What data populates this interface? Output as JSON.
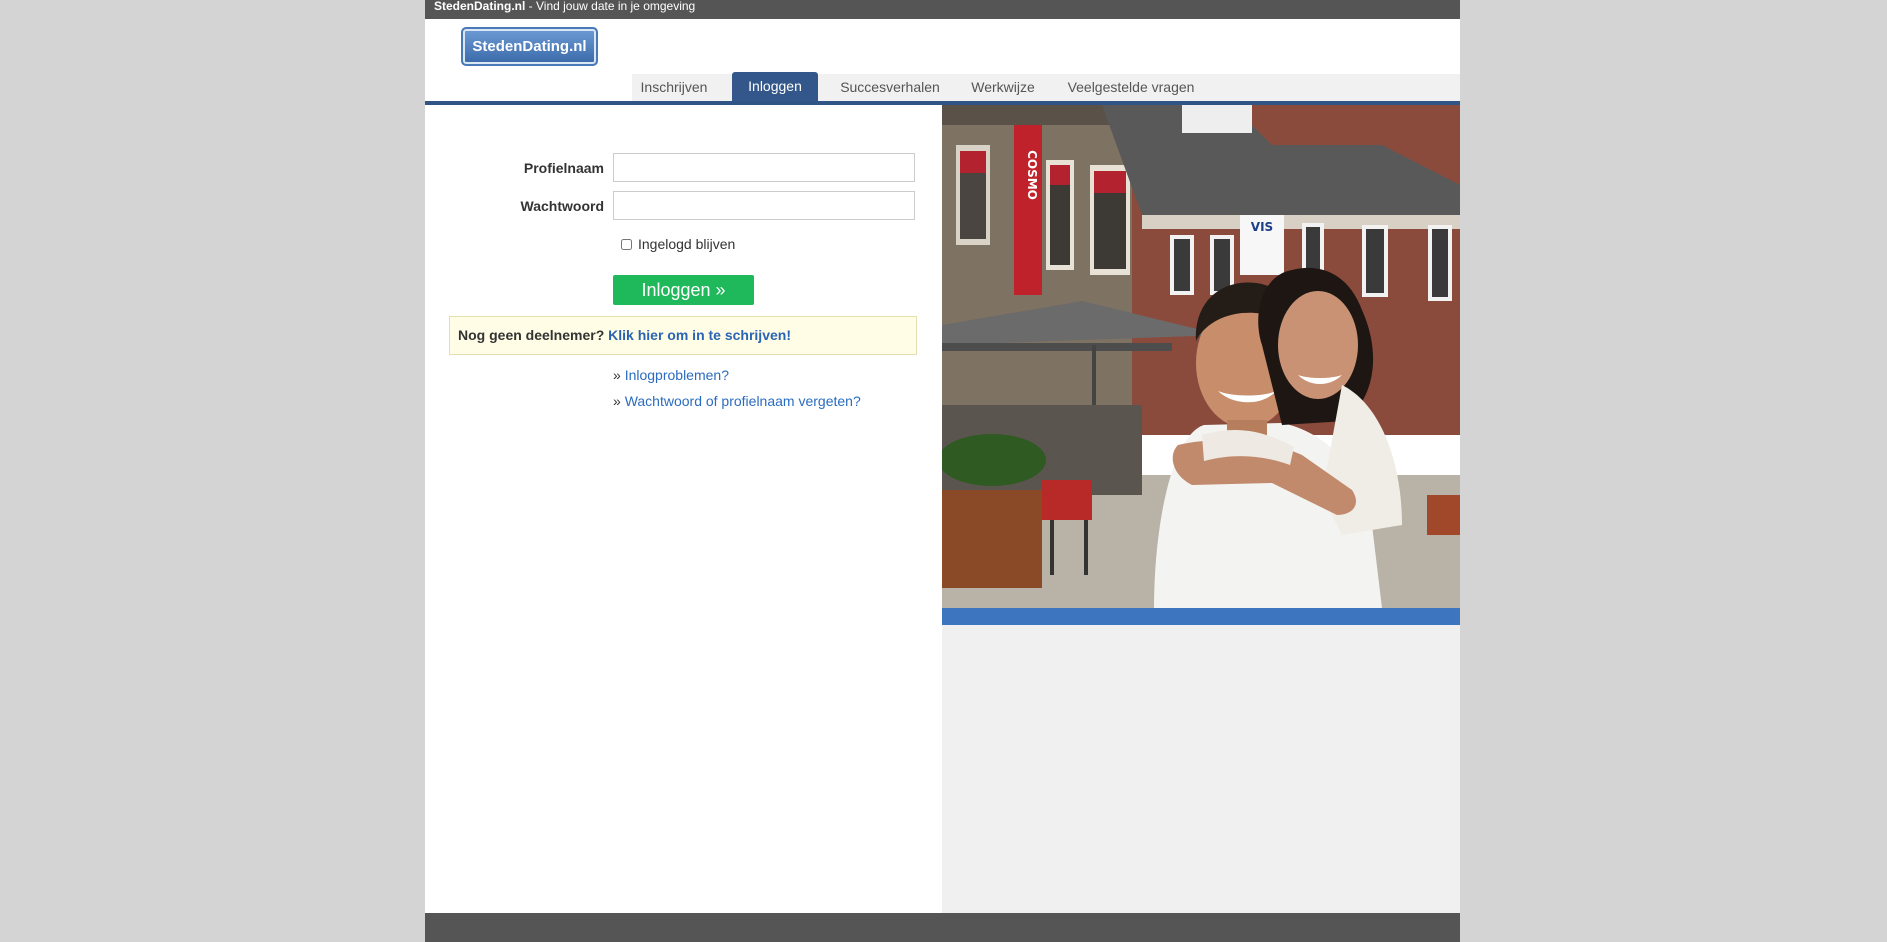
{
  "topbar": {
    "site_name": "StedenDating.nl",
    "tagline": " - Vind jouw date in je omgeving"
  },
  "header": {
    "logo_text": "StedenDating.nl"
  },
  "nav": {
    "tabs": [
      {
        "label": "Inschrijven",
        "active": false
      },
      {
        "label": "Inloggen",
        "active": true
      },
      {
        "label": "Succesverhalen",
        "active": false
      },
      {
        "label": "Werkwijze",
        "active": false
      },
      {
        "label": "Veelgestelde vragen",
        "active": false
      }
    ]
  },
  "login": {
    "profile_label": "Profielnaam",
    "profile_value": "",
    "password_label": "Wachtwoord",
    "password_value": "",
    "remember_label": "Ingelogd blijven",
    "remember_checked": false,
    "submit_label": "Inloggen »"
  },
  "notice": {
    "question": "Nog geen deelnemer?",
    "link_text": "Klik hier om in te schrijven!"
  },
  "help_links": [
    {
      "prefix": "» ",
      "text": "Inlogproblemen?"
    },
    {
      "prefix": "» ",
      "text": "Wachtwoord of profielnaam vergeten?"
    }
  ],
  "photo": {
    "storefront_sign": "COSMO",
    "shop_sign": "VIS"
  },
  "colors": {
    "nav_active": "#33578a",
    "button_green": "#1fb85a",
    "link_blue": "#2a6cbf",
    "photo_bar": "#3d76be",
    "frame_gray": "#555555"
  }
}
